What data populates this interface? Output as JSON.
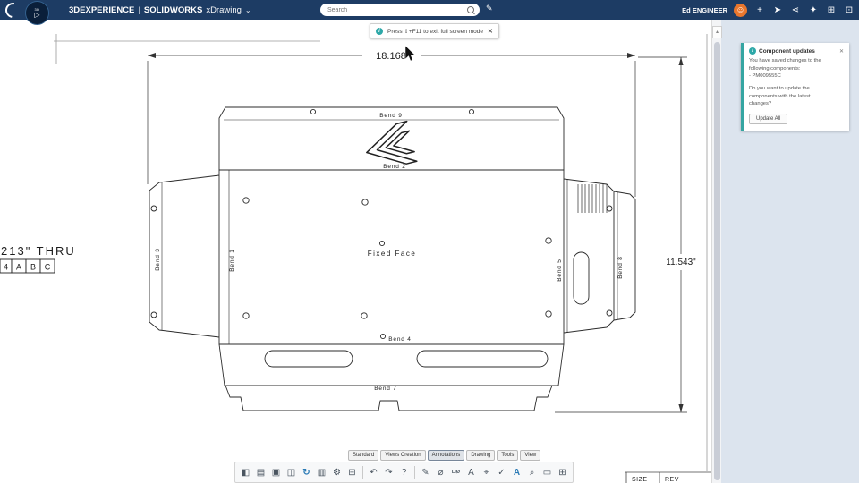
{
  "topbar": {
    "brand": "3DEXPERIENCE",
    "sep": "|",
    "app": "SOLIDWORKS",
    "mode": "xDrawing",
    "caret": "⌄",
    "compass_top": "3D",
    "compass_glyph": "▷",
    "search": {
      "placeholder": "Search"
    },
    "tag_glyph": "✎",
    "user": "Ed ENGINEER",
    "avatar_glyph": "☺",
    "icons": [
      {
        "name": "add-icon",
        "glyph": "+"
      },
      {
        "name": "share-icon",
        "glyph": "➤"
      },
      {
        "name": "collaborate-icon",
        "glyph": "⋖"
      },
      {
        "name": "favorites-icon",
        "glyph": "✦"
      },
      {
        "name": "apps-grid-icon",
        "glyph": "⊞"
      },
      {
        "name": "fullscreen-icon",
        "glyph": "⊡"
      }
    ]
  },
  "toast": {
    "icon": "i",
    "text": "Press ⇧+F11 to exit full screen mode",
    "close": "✕"
  },
  "update_panel": {
    "icon": "i",
    "title": "Component updates",
    "close": "✕",
    "message_line1": "You have saved changes to the",
    "message_line2": "following components:",
    "component": "- PM009555C",
    "question_line1": "Do you want to update the",
    "question_line2": "components with the latest",
    "question_line3": "changes?",
    "button": "Update All"
  },
  "scrollbar": {
    "up_glyph": "▴"
  },
  "drawing": {
    "dim_width": "18.168",
    "dim_height": "11.543\"",
    "fixed_face": "Fixed Face",
    "thru_note": "213\" THRU",
    "datum_cells": [
      "4",
      "A",
      "B",
      "C"
    ],
    "bend_labels": {
      "bend1": "Bend 1",
      "bend2": "Bend 2",
      "bend3": "Bend 3",
      "bend4": "Bend 4",
      "bend5": "Bend 5",
      "bend7": "Bend 7",
      "bend8": "Bend 8",
      "bend9": "Bend 9"
    },
    "title_block": {
      "size": "SIZE",
      "rev": "REV"
    }
  },
  "ribbon": {
    "tabs": [
      {
        "label": "Standard"
      },
      {
        "label": "Views Creation"
      },
      {
        "label": "Annotations"
      },
      {
        "label": "Drawing"
      },
      {
        "label": "Tools"
      },
      {
        "label": "View"
      }
    ],
    "active_tab": "Annotations",
    "icons": [
      {
        "name": "view-style-icon",
        "glyph": "◧"
      },
      {
        "name": "drawing-view-icon",
        "glyph": "▤"
      },
      {
        "name": "save-icon",
        "glyph": "▣"
      },
      {
        "name": "model-view-icon",
        "glyph": "◫"
      },
      {
        "name": "update-views-icon",
        "glyph": "↻",
        "accent": true
      },
      {
        "name": "sheet-icon",
        "glyph": "▥"
      },
      {
        "name": "settings-icon",
        "glyph": "⚙"
      },
      {
        "name": "export-icon",
        "glyph": "⊟"
      },
      {
        "divider": true
      },
      {
        "name": "undo-icon",
        "glyph": "↶"
      },
      {
        "name": "redo-icon",
        "glyph": "↷"
      },
      {
        "name": "help-icon",
        "glyph": "?"
      },
      {
        "divider": true
      },
      {
        "name": "sketch-line-icon",
        "glyph": "✎"
      },
      {
        "name": "smart-dimension-icon",
        "glyph": "⌀"
      },
      {
        "name": "dimension-group-icon",
        "glyph": "LIØ"
      },
      {
        "name": "note-icon",
        "glyph": "A"
      },
      {
        "name": "datum-target-icon",
        "glyph": "⌖"
      },
      {
        "name": "spellcheck-icon",
        "glyph": "✓"
      },
      {
        "name": "format-text-icon",
        "glyph": "A",
        "accent": true
      },
      {
        "name": "magnifier-icon",
        "glyph": "⌕"
      },
      {
        "name": "comment-icon",
        "glyph": "▭"
      },
      {
        "name": "table-icon",
        "glyph": "⊞"
      }
    ]
  }
}
